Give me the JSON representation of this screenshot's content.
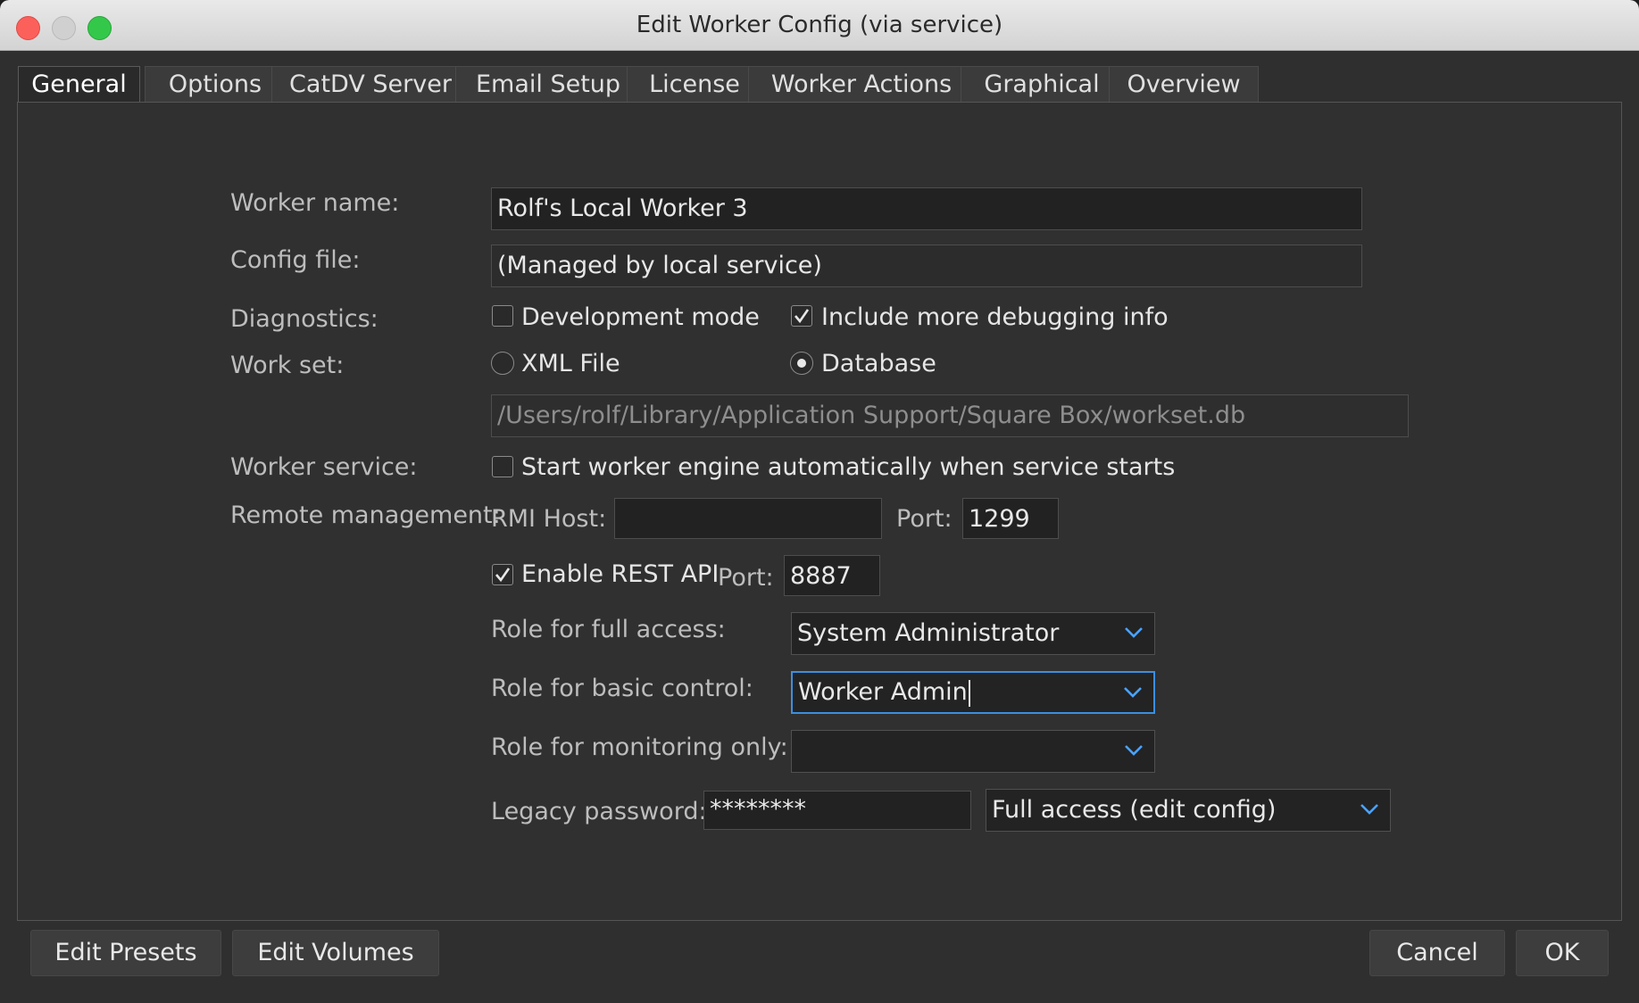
{
  "window": {
    "title": "Edit Worker Config (via service)"
  },
  "tabs": [
    {
      "label": "General",
      "active": true
    },
    {
      "label": "Options"
    },
    {
      "label": "CatDV Server"
    },
    {
      "label": "Email Setup"
    },
    {
      "label": "License"
    },
    {
      "label": "Worker Actions"
    },
    {
      "label": "Graphical"
    },
    {
      "label": "Overview"
    }
  ],
  "form": {
    "worker_name": {
      "label": "Worker name:",
      "value": "Rolf's Local Worker 3"
    },
    "config_file": {
      "label": "Config file:",
      "value": "(Managed by local service)"
    },
    "diagnostics": {
      "label": "Diagnostics:",
      "development_mode": {
        "label": "Development mode",
        "checked": false
      },
      "more_debugging": {
        "label": "Include more debugging info",
        "checked": true
      }
    },
    "work_set": {
      "label": "Work set:",
      "xml_file": {
        "label": "XML File",
        "selected": false
      },
      "database": {
        "label": "Database",
        "selected": true
      },
      "path": "/Users/rolf/Library/Application Support/Square Box/workset.db"
    },
    "worker_service": {
      "label": "Worker service:",
      "auto_start": {
        "label": "Start worker engine automatically when service starts",
        "checked": false
      }
    },
    "remote_management": {
      "label": "Remote management:",
      "rmi_host_label": "RMI Host:",
      "rmi_host_value": "",
      "rmi_port_label": "Port:",
      "rmi_port_value": "1299",
      "rest_api": {
        "label": "Enable REST API",
        "checked": true
      },
      "rest_port_label": "Port:",
      "rest_port_value": "8887"
    },
    "roles": {
      "full_access": {
        "label": "Role for full access:",
        "value": "System Administrator"
      },
      "basic_control": {
        "label": "Role for basic control:",
        "value": "Worker Admin"
      },
      "monitoring_only": {
        "label": "Role for monitoring only:",
        "value": ""
      }
    },
    "legacy_password": {
      "label": "Legacy password:",
      "value": "********",
      "access_level": "Full access (edit config)"
    }
  },
  "buttons": {
    "edit_presets": "Edit Presets",
    "edit_volumes": "Edit Volumes",
    "cancel": "Cancel",
    "ok": "OK"
  },
  "colors": {
    "close": "#fc605b",
    "minimize": "#d0d0d0",
    "zoom": "#34c84a",
    "focus_accent": "#3c8fe0",
    "chevron": "#4aa3ff"
  }
}
